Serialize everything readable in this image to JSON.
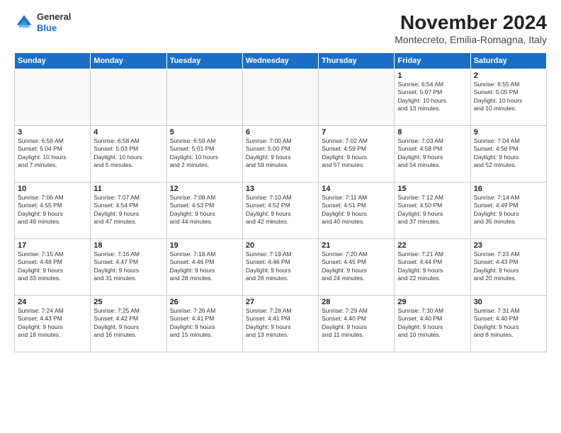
{
  "header": {
    "logo_line1": "General",
    "logo_line2": "Blue",
    "title": "November 2024",
    "subtitle": "Montecreto, Emilia-Romagna, Italy"
  },
  "columns": [
    "Sunday",
    "Monday",
    "Tuesday",
    "Wednesday",
    "Thursday",
    "Friday",
    "Saturday"
  ],
  "weeks": [
    [
      {
        "day": "",
        "info": ""
      },
      {
        "day": "",
        "info": ""
      },
      {
        "day": "",
        "info": ""
      },
      {
        "day": "",
        "info": ""
      },
      {
        "day": "",
        "info": ""
      },
      {
        "day": "1",
        "info": "Sunrise: 6:54 AM\nSunset: 5:07 PM\nDaylight: 10 hours\nand 13 minutes."
      },
      {
        "day": "2",
        "info": "Sunrise: 6:55 AM\nSunset: 5:05 PM\nDaylight: 10 hours\nand 10 minutes."
      }
    ],
    [
      {
        "day": "3",
        "info": "Sunrise: 6:56 AM\nSunset: 5:04 PM\nDaylight: 10 hours\nand 7 minutes."
      },
      {
        "day": "4",
        "info": "Sunrise: 6:58 AM\nSunset: 5:03 PM\nDaylight: 10 hours\nand 5 minutes."
      },
      {
        "day": "5",
        "info": "Sunrise: 6:59 AM\nSunset: 5:01 PM\nDaylight: 10 hours\nand 2 minutes."
      },
      {
        "day": "6",
        "info": "Sunrise: 7:00 AM\nSunset: 5:00 PM\nDaylight: 9 hours\nand 59 minutes."
      },
      {
        "day": "7",
        "info": "Sunrise: 7:02 AM\nSunset: 4:59 PM\nDaylight: 9 hours\nand 57 minutes."
      },
      {
        "day": "8",
        "info": "Sunrise: 7:03 AM\nSunset: 4:58 PM\nDaylight: 9 hours\nand 54 minutes."
      },
      {
        "day": "9",
        "info": "Sunrise: 7:04 AM\nSunset: 4:56 PM\nDaylight: 9 hours\nand 52 minutes."
      }
    ],
    [
      {
        "day": "10",
        "info": "Sunrise: 7:06 AM\nSunset: 4:55 PM\nDaylight: 9 hours\nand 49 minutes."
      },
      {
        "day": "11",
        "info": "Sunrise: 7:07 AM\nSunset: 4:54 PM\nDaylight: 9 hours\nand 47 minutes."
      },
      {
        "day": "12",
        "info": "Sunrise: 7:08 AM\nSunset: 4:53 PM\nDaylight: 9 hours\nand 44 minutes."
      },
      {
        "day": "13",
        "info": "Sunrise: 7:10 AM\nSunset: 4:52 PM\nDaylight: 9 hours\nand 42 minutes."
      },
      {
        "day": "14",
        "info": "Sunrise: 7:11 AM\nSunset: 4:51 PM\nDaylight: 9 hours\nand 40 minutes."
      },
      {
        "day": "15",
        "info": "Sunrise: 7:12 AM\nSunset: 4:50 PM\nDaylight: 9 hours\nand 37 minutes."
      },
      {
        "day": "16",
        "info": "Sunrise: 7:14 AM\nSunset: 4:49 PM\nDaylight: 9 hours\nand 35 minutes."
      }
    ],
    [
      {
        "day": "17",
        "info": "Sunrise: 7:15 AM\nSunset: 4:48 PM\nDaylight: 9 hours\nand 33 minutes."
      },
      {
        "day": "18",
        "info": "Sunrise: 7:16 AM\nSunset: 4:47 PM\nDaylight: 9 hours\nand 31 minutes."
      },
      {
        "day": "19",
        "info": "Sunrise: 7:18 AM\nSunset: 4:46 PM\nDaylight: 9 hours\nand 28 minutes."
      },
      {
        "day": "20",
        "info": "Sunrise: 7:19 AM\nSunset: 4:46 PM\nDaylight: 9 hours\nand 26 minutes."
      },
      {
        "day": "21",
        "info": "Sunrise: 7:20 AM\nSunset: 4:45 PM\nDaylight: 9 hours\nand 24 minutes."
      },
      {
        "day": "22",
        "info": "Sunrise: 7:21 AM\nSunset: 4:44 PM\nDaylight: 9 hours\nand 22 minutes."
      },
      {
        "day": "23",
        "info": "Sunrise: 7:23 AM\nSunset: 4:43 PM\nDaylight: 9 hours\nand 20 minutes."
      }
    ],
    [
      {
        "day": "24",
        "info": "Sunrise: 7:24 AM\nSunset: 4:43 PM\nDaylight: 9 hours\nand 18 minutes."
      },
      {
        "day": "25",
        "info": "Sunrise: 7:25 AM\nSunset: 4:42 PM\nDaylight: 9 hours\nand 16 minutes."
      },
      {
        "day": "26",
        "info": "Sunrise: 7:26 AM\nSunset: 4:41 PM\nDaylight: 9 hours\nand 15 minutes."
      },
      {
        "day": "27",
        "info": "Sunrise: 7:28 AM\nSunset: 4:41 PM\nDaylight: 9 hours\nand 13 minutes."
      },
      {
        "day": "28",
        "info": "Sunrise: 7:29 AM\nSunset: 4:40 PM\nDaylight: 9 hours\nand 11 minutes."
      },
      {
        "day": "29",
        "info": "Sunrise: 7:30 AM\nSunset: 4:40 PM\nDaylight: 9 hours\nand 10 minutes."
      },
      {
        "day": "30",
        "info": "Sunrise: 7:31 AM\nSunset: 4:40 PM\nDaylight: 9 hours\nand 8 minutes."
      }
    ]
  ]
}
